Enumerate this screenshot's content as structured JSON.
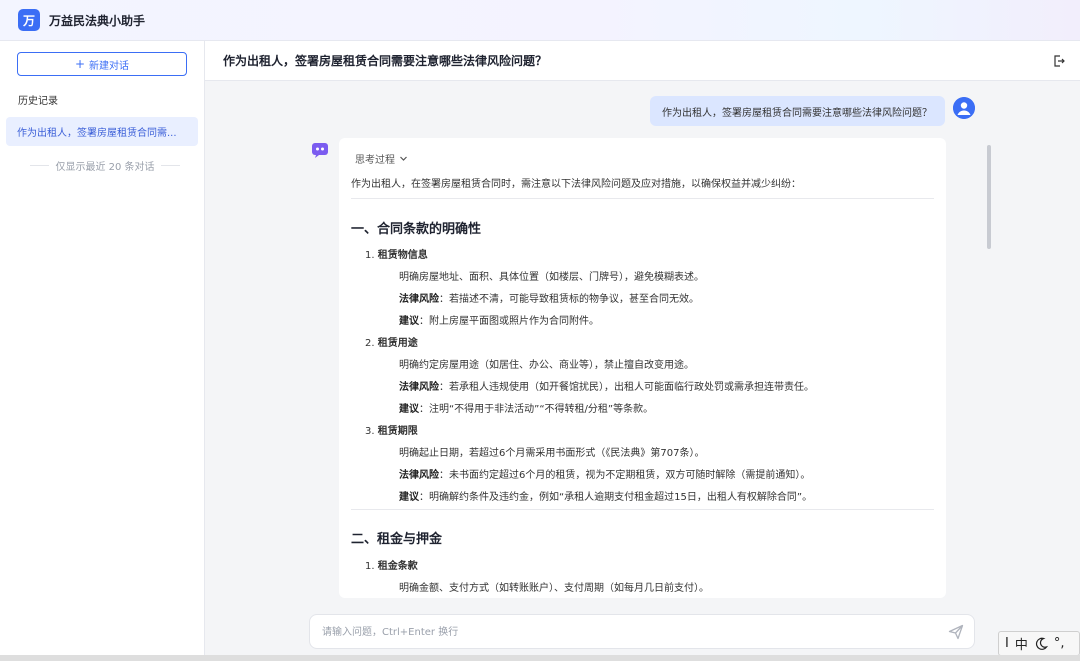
{
  "app": {
    "logo_char": "万",
    "title": "万益民法典小助手"
  },
  "sidebar": {
    "new_chat_label": "新建对话",
    "history_title": "历史记录",
    "history_items": [
      {
        "label": "作为出租人，签署房屋租赁合同需..."
      }
    ],
    "history_note": "仅显示最近 20 条对话"
  },
  "main": {
    "title": "作为出租人，签署房屋租赁合同需要注意哪些法律风险问题？",
    "user_message": "作为出租人，签署房屋租赁合同需要注意哪些法律风险问题？",
    "answer": {
      "think_label": "思考过程",
      "intro": "作为出租人，在签署房屋租赁合同时，需注意以下法律风险问题及应对措施，以确保权益并减少纠纷：",
      "sections": [
        {
          "heading": "一、合同条款的明确性",
          "items": [
            {
              "num": "1.",
              "title": "租赁物信息",
              "lines": [
                {
                  "label": "",
                  "text": "明确房屋地址、面积、具体位置（如楼层、门牌号），避免模糊表述。"
                },
                {
                  "label": "法律风险",
                  "text": "：若描述不清，可能导致租赁标的物争议，甚至合同无效。"
                },
                {
                  "label": "建议",
                  "text": "：附上房屋平面图或照片作为合同附件。"
                }
              ]
            },
            {
              "num": "2.",
              "title": "租赁用途",
              "lines": [
                {
                  "label": "",
                  "text": "明确约定房屋用途（如居住、办公、商业等），禁止擅自改变用途。"
                },
                {
                  "label": "法律风险",
                  "text": "：若承租人违规使用（如开餐馆扰民），出租人可能面临行政处罚或需承担连带责任。"
                },
                {
                  "label": "建议",
                  "text": "：注明“不得用于非法活动”“不得转租/分租”等条款。"
                }
              ]
            },
            {
              "num": "3.",
              "title": "租赁期限",
              "lines": [
                {
                  "label": "",
                  "text": "明确起止日期，若超过6个月需采用书面形式（《民法典》第707条）。"
                },
                {
                  "label": "法律风险",
                  "text": "：未书面约定超过6个月的租赁，视为不定期租赁，双方可随时解除（需提前通知）。"
                },
                {
                  "label": "建议",
                  "text": "：明确解约条件及违约金，例如“承租人逾期支付租金超过15日，出租人有权解除合同”。"
                }
              ]
            }
          ]
        },
        {
          "heading": "二、租金与押金",
          "items": [
            {
              "num": "1.",
              "title": "租金条款",
              "lines": [
                {
                  "label": "",
                  "text": "明确金额、支付方式（如转账账户）、支付周期（如每月几日前支付）。"
                }
              ]
            }
          ]
        }
      ]
    },
    "input_placeholder": "请输入问题，Ctrl+Enter 换行"
  },
  "ime": {
    "cursor": "I",
    "lang": "中",
    "punct": "°,"
  },
  "colors": {
    "accent": "#3b6ef5",
    "user_bubble": "#dbe6ff",
    "history_active": "#e9efff"
  }
}
